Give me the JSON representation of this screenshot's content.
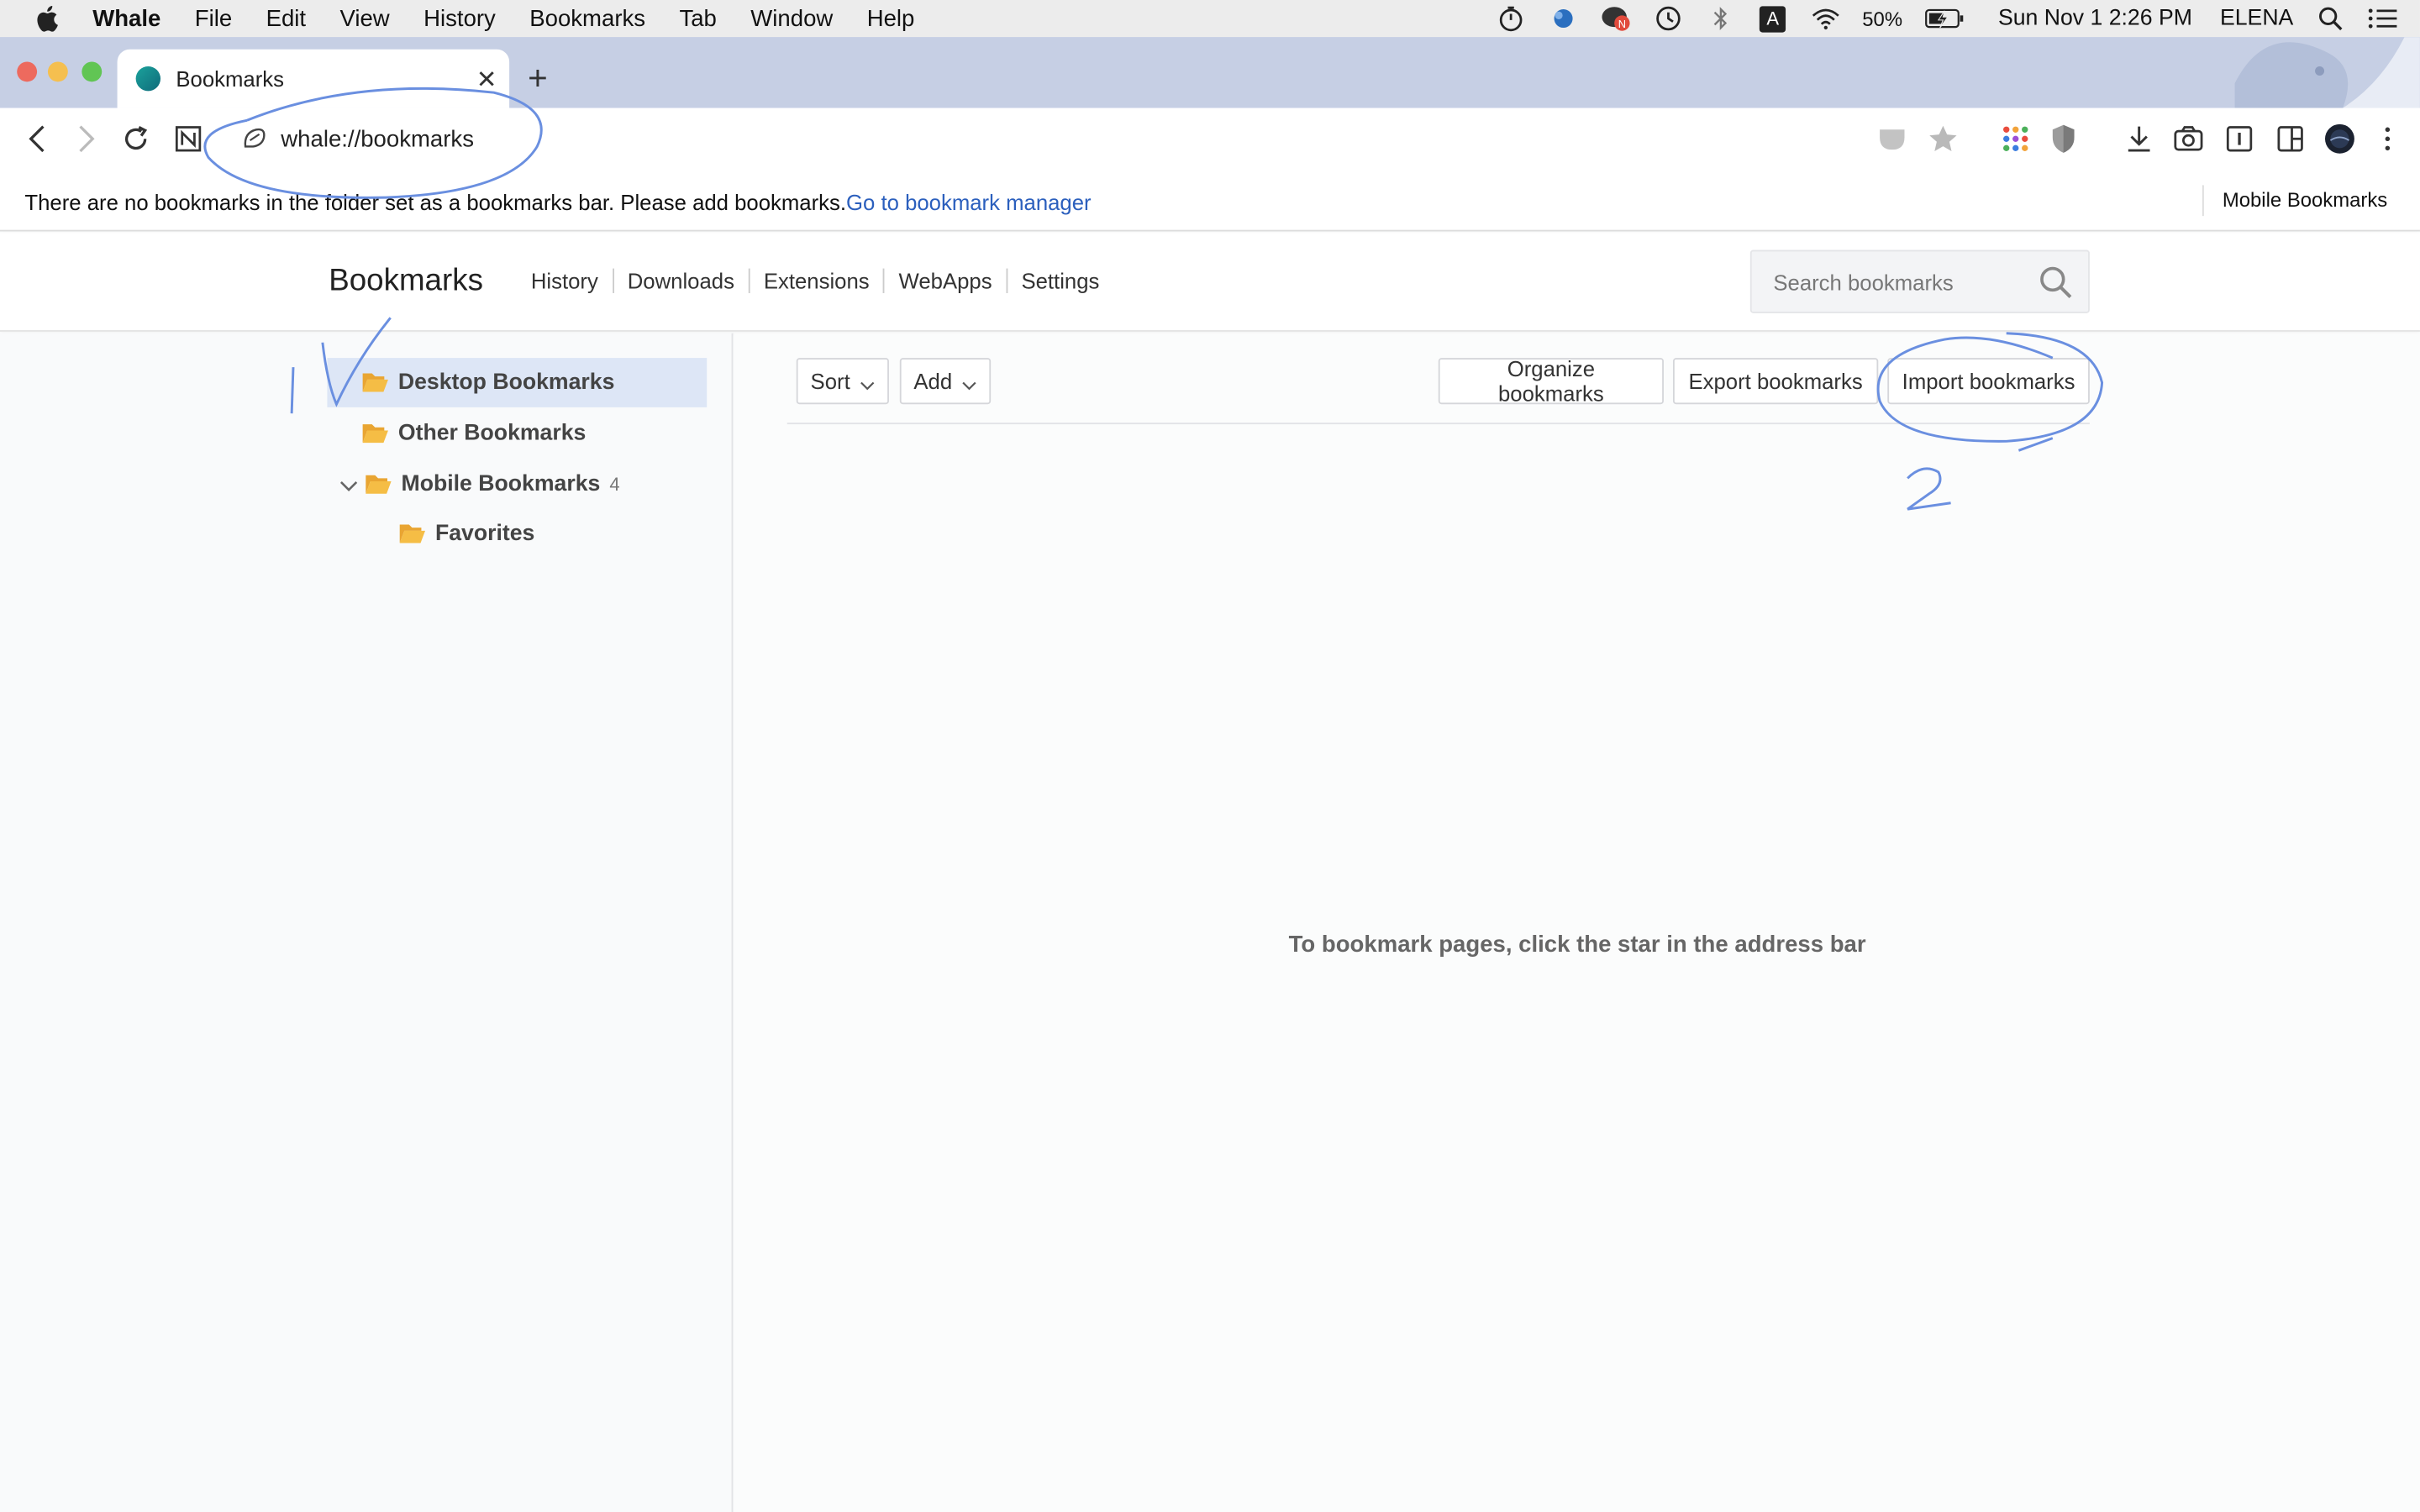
{
  "menubar": {
    "app_name": "Whale",
    "items": [
      "File",
      "Edit",
      "View",
      "History",
      "Bookmarks",
      "Tab",
      "Window",
      "Help"
    ],
    "battery": "50%",
    "datetime": "Sun Nov 1  2:26 PM",
    "user": "ELENA",
    "input_source": "A"
  },
  "tab": {
    "title": "Bookmarks",
    "close_symbol": "✕",
    "new_tab_symbol": "+"
  },
  "toolbar": {
    "url": "whale://bookmarks"
  },
  "bookmark_bar": {
    "message": "There are no bookmarks in the folder set as a bookmarks bar. Please add bookmarks.",
    "link": "Go to bookmark manager",
    "mobile_label": "Mobile Bookmarks"
  },
  "header": {
    "title": "Bookmarks",
    "nav": [
      "History",
      "Downloads",
      "Extensions",
      "WebApps",
      "Settings"
    ],
    "search_placeholder": "Search bookmarks"
  },
  "sidebar": {
    "folders": [
      {
        "label": "Desktop Bookmarks",
        "selected": true
      },
      {
        "label": "Other Bookmarks"
      },
      {
        "label": "Mobile Bookmarks",
        "count": "4",
        "expanded": true
      },
      {
        "label": "Favorites"
      }
    ]
  },
  "main": {
    "sort_label": "Sort",
    "add_label": "Add",
    "organize_label": "Organize bookmarks",
    "export_label": "Export bookmarks",
    "import_label": "Import bookmarks",
    "empty_message": "To bookmark pages, click the star in the address bar"
  },
  "colors": {
    "accent": "#2b5fbd",
    "selected_row": "#dde6f6",
    "folder": "#f3b83f",
    "annotation": "#6a8fe0"
  }
}
